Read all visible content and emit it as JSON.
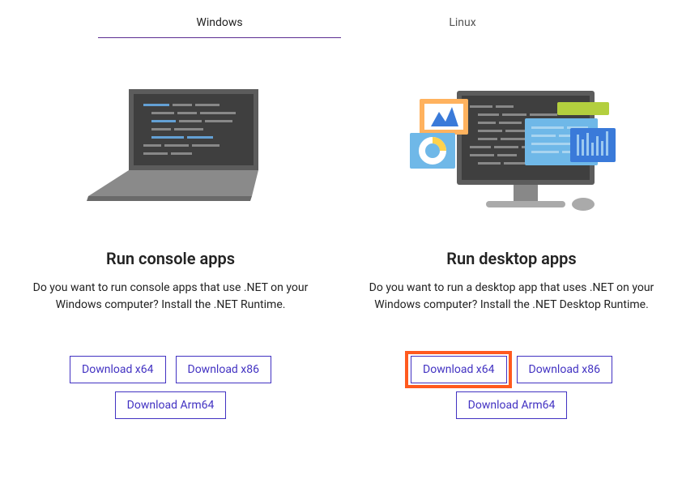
{
  "tabs": {
    "windows": "Windows",
    "linux": "Linux"
  },
  "console": {
    "title": "Run console apps",
    "desc": "Do you want to run console apps that use .NET on your Windows computer? Install the .NET Runtime.",
    "btn_x64": "Download x64",
    "btn_x86": "Download x86",
    "btn_arm64": "Download Arm64"
  },
  "desktop": {
    "title": "Run desktop apps",
    "desc": "Do you want to run a desktop app that uses .NET on your Windows computer? Install the .NET Desktop Runtime.",
    "btn_x64": "Download x64",
    "btn_x86": "Download x86",
    "btn_arm64": "Download Arm64"
  }
}
